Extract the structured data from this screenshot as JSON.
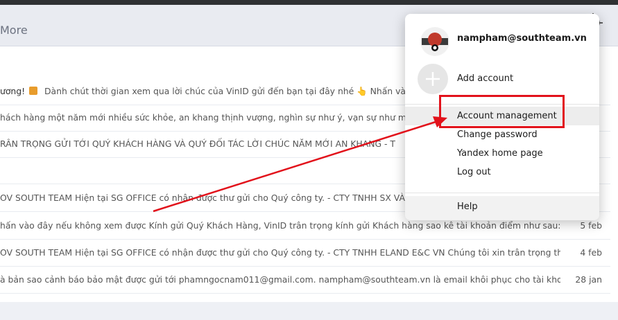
{
  "toolbar": {
    "more_label": "More"
  },
  "colors": {
    "accent_red": "#e2121b",
    "panel_bg": "#ffffff"
  },
  "emails": [
    {
      "text_prefix": "ương! ",
      "text_rest": "Dành chút thời gian xem qua lời chúc của VinID gửi đến bạn tại đây nhé 👆 Nhấn vào đây",
      "date": "",
      "has_icon": true
    },
    {
      "text_prefix": "",
      "text_rest": "hách hàng một năm mới nhiều sức khỏe, an khang thịnh vượng, nghìn sự như ý, vạn sự như mơ và t",
      "date": ""
    },
    {
      "text_prefix": "",
      "text_rest": "RÂN TRỌNG GỬI TỚI QUÝ KHÁCH HÀNG VÀ QUÝ ĐỐI TÁC LỜI CHÚC NĂM MỚI AN KHANG - T",
      "date": ""
    },
    {
      "text_prefix": "",
      "text_rest": "",
      "date": ""
    },
    {
      "text_prefix": "",
      "text_rest": "OV SOUTH TEAM Hiện tại SG OFFICE có nhận được thư gửi cho Quý công ty. - CTY TNHH SX VÀ T",
      "date": ""
    },
    {
      "text_prefix": "",
      "text_rest": "hấn vào đây nếu không xem được Kính gửi Quý Khách Hàng, VinID trân trọng kính gửi Khách hàng sao kê tài khoản điểm như sau: Mã th...",
      "date": "5 feb"
    },
    {
      "text_prefix": "",
      "text_rest": "OV SOUTH TEAM Hiện tại SG OFFICE có nhận được thư gửi cho Quý công ty. - CTY TNHH ELAND E&C VN Chúng tôi xin trân trọng thô...",
      "date": "4 feb"
    },
    {
      "text_prefix": "",
      "text_rest": "à bản sao cảnh báo bảo mật được gửi tới phamngocnam011@gmail.com. nampham@southteam.vn là email khôi phục cho tài khoản này...",
      "date": "28 jan"
    }
  ],
  "dropdown": {
    "email": "nampham@southteam.vn",
    "add_account": "Add account",
    "items": [
      {
        "label": "Account management",
        "active": true
      },
      {
        "label": "Change password"
      },
      {
        "label": "Yandex home page"
      },
      {
        "label": "Log out"
      }
    ],
    "help": "Help"
  }
}
